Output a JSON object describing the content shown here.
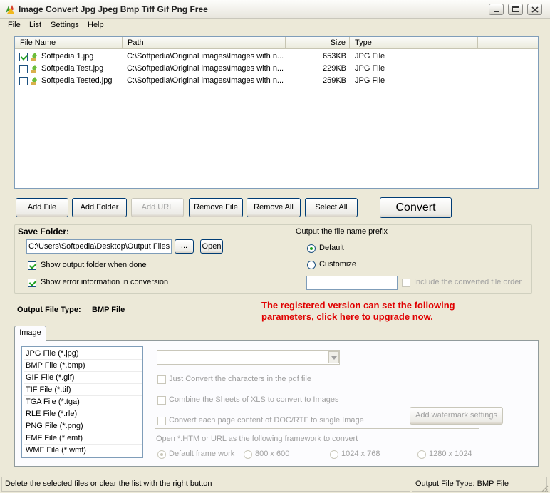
{
  "window": {
    "title": "Image Convert Jpg Jpeg Bmp Tiff Gif Png Free"
  },
  "menu": [
    "File",
    "List",
    "Settings",
    "Help"
  ],
  "file_list": {
    "columns": [
      "File Name",
      "Path",
      "Size",
      "Type"
    ],
    "rows": [
      {
        "checked": true,
        "name": "Softpedia 1.jpg",
        "path": "C:\\Softpedia\\Original images\\Images with n...",
        "size": "653KB",
        "type": "JPG File"
      },
      {
        "checked": false,
        "name": "Softpedia Test.jpg",
        "path": "C:\\Softpedia\\Original images\\Images with n...",
        "size": "229KB",
        "type": "JPG File"
      },
      {
        "checked": false,
        "name": "Softpedia Tested.jpg",
        "path": "C:\\Softpedia\\Original images\\Images with n...",
        "size": "259KB",
        "type": "JPG File"
      }
    ]
  },
  "buttons": {
    "add_file": "Add File",
    "add_folder": "Add Folder",
    "add_url": "Add URL",
    "remove_file": "Remove File",
    "remove_all": "Remove All",
    "select_all": "Select All",
    "convert": "Convert"
  },
  "save_folder": {
    "label": "Save Folder:",
    "path": "C:\\Users\\Softpedia\\Desktop\\Output Files",
    "browse_label": "...",
    "open_label": "Open",
    "show_output_folder": {
      "label": "Show output folder when done",
      "checked": true
    },
    "show_error_info": {
      "label": "Show error information in conversion",
      "checked": true
    }
  },
  "prefix": {
    "label": "Output the file name prefix",
    "default_label": "Default",
    "customize_label": "Customize",
    "selected": "Default",
    "custom_value": "",
    "include_order_label": "Include the converted file order"
  },
  "output_type": {
    "label": "Output File Type:",
    "value": "BMP File"
  },
  "upgrade_message": {
    "line1": "The registered version can set the following",
    "line2": "parameters, click here to upgrade now."
  },
  "tabs": [
    "Image"
  ],
  "file_types": [
    "JPG File  (*.jpg)",
    "BMP File  (*.bmp)",
    "GIF File  (*.gif)",
    "TIF File  (*.tif)",
    "TGA File  (*.tga)",
    "RLE File  (*.rle)",
    "PNG File  (*.png)",
    "EMF File  (*.emf)",
    "WMF File  (*.wmf)"
  ],
  "options": {
    "dropdown_value": "",
    "just_convert_pdf": "Just Convert the characters in the pdf file",
    "combine_xls": "Combine the Sheets of XLS to convert to Images",
    "convert_doc_rtf": "Convert each page content of DOC/RTF to single Image",
    "watermark_button": "Add watermark settings",
    "framework_label": "Open *.HTM or URL as the following framework to convert",
    "frames": [
      {
        "label": "Default frame work",
        "selected": true
      },
      {
        "label": "800 x 600",
        "selected": false
      },
      {
        "label": "1024 x 768",
        "selected": false
      },
      {
        "label": "1280 x 1024",
        "selected": false
      }
    ]
  },
  "status": {
    "message": "Delete the selected files or clear the list with the right button",
    "output_type": "Output File Type:  BMP File"
  }
}
